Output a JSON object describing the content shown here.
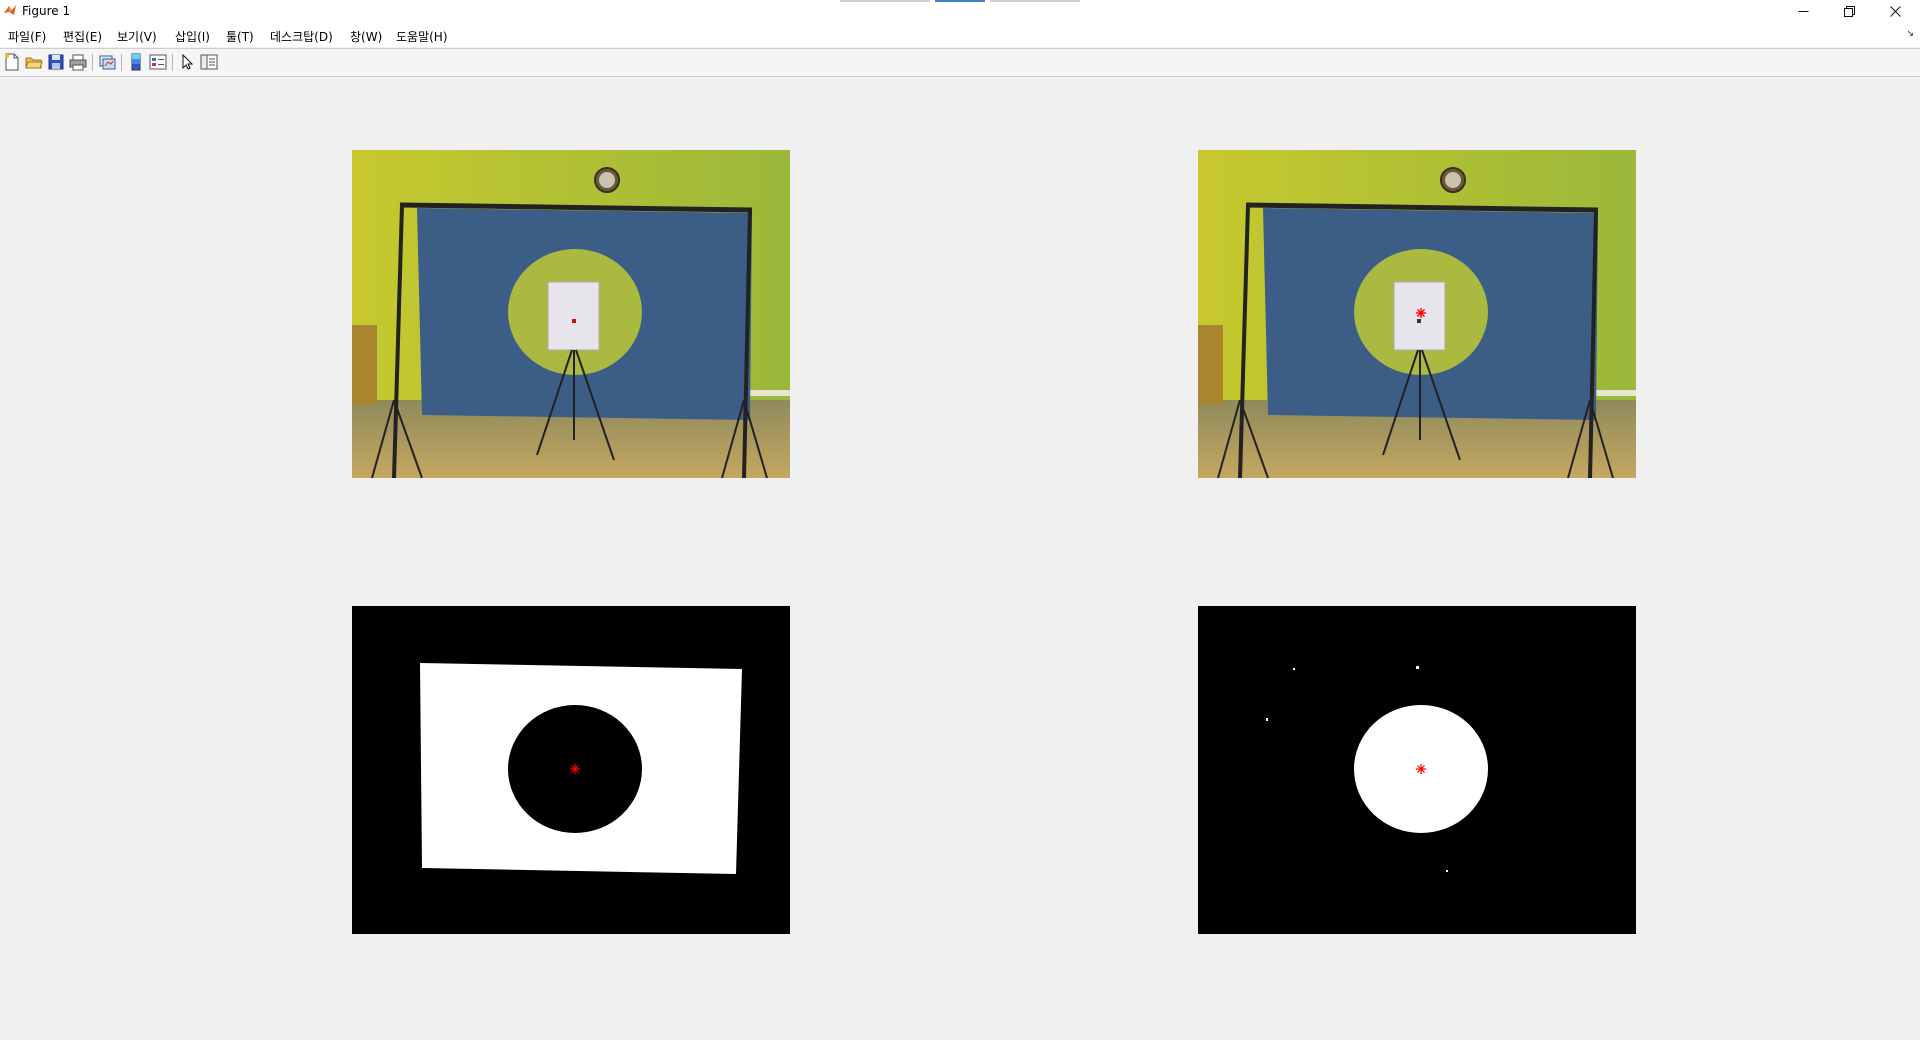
{
  "window": {
    "title": "Figure 1"
  },
  "menu": {
    "items": [
      "파일(F)",
      "편집(E)",
      "보기(V)",
      "삽입(I)",
      "툴(T)",
      "데스크탑(D)",
      "창(W)",
      "도움말(H)"
    ]
  },
  "toolbar": {
    "buttons": [
      "new-figure-icon",
      "open-file-icon",
      "save-icon",
      "print-icon",
      "link-plot-icon",
      "insert-colorbar-icon",
      "insert-legend-icon",
      "edit-plot-arrow-icon",
      "property-inspector-icon"
    ]
  },
  "figure": {
    "subplots": [
      {
        "kind": "photo",
        "marker": "red square at target center"
      },
      {
        "kind": "photo",
        "marker": "red asterisk at target center"
      },
      {
        "kind": "binary-mask",
        "foreground": "blue backdrop",
        "marker": "red asterisk"
      },
      {
        "kind": "binary-mask",
        "foreground": "yellow circle",
        "marker": "red asterisk"
      }
    ],
    "colors": {
      "wall": "#b7c22d",
      "backdrop": "#3c5d86",
      "circle": "#aab940",
      "floor": "#b59a5c",
      "marker": "#ff0000"
    }
  }
}
